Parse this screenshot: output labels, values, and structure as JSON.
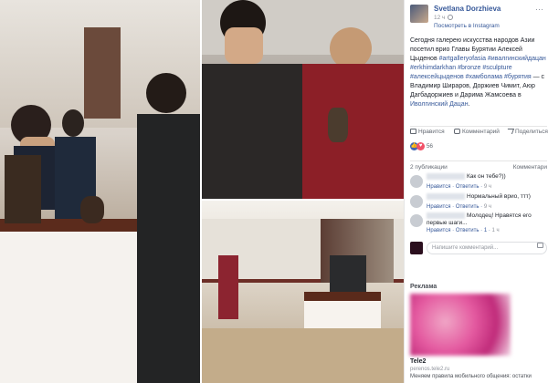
{
  "post": {
    "author": "Svetlana Dorzhieva",
    "time": "12 ч",
    "via": "Посмотреть в Instagram",
    "text_main": "Сегодня галерею искусства народов Азии посетил врио Главы Бурятии Алексей Цыденов ",
    "text_tags": "#artgalleryofasia #ивалгинскийдацан #erkhimdarkhan #bronze #sculpture #алексейцыденов #хамболама #бурятия",
    "text_with": " — с Владимир Шираров, Доржиев Чимит, Аюр Дагбадоржиев и Дарима Жамсоева в ",
    "place": "Иволгинский Дацан",
    "place_end": "."
  },
  "actions": {
    "like": "Нравится",
    "comment": "Комментарий",
    "share": "Поделиться"
  },
  "reactions": {
    "count": "56"
  },
  "shares": {
    "count": "2 публикации",
    "comments_label": "Комментари"
  },
  "comments": [
    {
      "text": "Как он тебе?))",
      "like": "Нравится",
      "reply": "Ответить",
      "time": "9 ч"
    },
    {
      "text": "Нормальный врио, ттт)",
      "like": "Нравится",
      "reply": "Ответить",
      "time": "9 ч"
    },
    {
      "text": "Молодец! Нравятся его первые шаги...",
      "like": "Нравится",
      "reply": "Ответить",
      "likes": "1",
      "time": "1 ч"
    }
  ],
  "write_placeholder": "Напишите комментарий...",
  "ads": {
    "title": "Реклама",
    "name": "Tele2",
    "url": "perenos.tele2.ru",
    "desc": "Меняем правила мобильного общения: остатки"
  },
  "colors": {
    "link": "#365899",
    "muted": "#90949c",
    "like_blue": "#4267b2",
    "love_red": "#f25268"
  }
}
